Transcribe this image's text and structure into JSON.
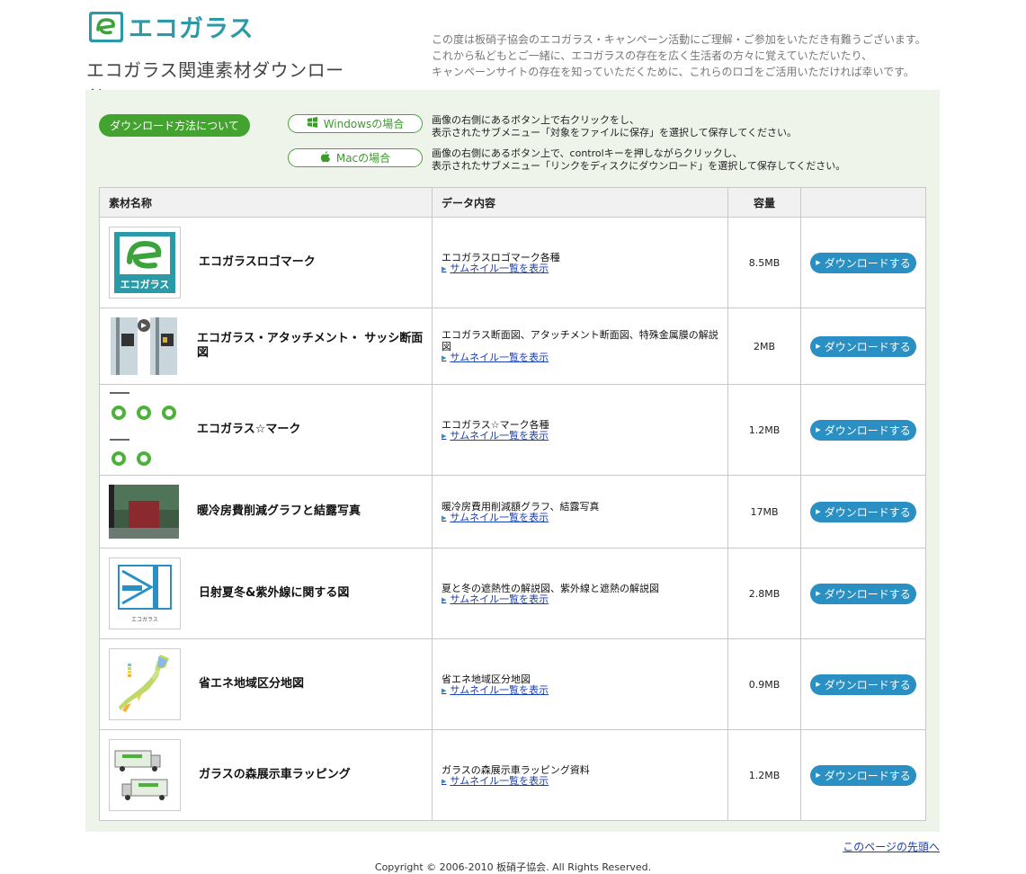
{
  "header": {
    "logo_text": "エコガラス",
    "page_title": "エコガラス関連素材ダウンロード",
    "intro": [
      "この度は板硝子協会のエコガラス・キャンペーン活動にご理解・ご参加をいただき有難うございます。",
      "これから私どもとご一緒に、エコガラスの存在を広く生活者の方々に覚えていただいたり、",
      "キャンペーンサイトの存在を知っていただくために、これらのロゴをご活用いただければ幸いです。"
    ]
  },
  "howto": {
    "button_label": "ダウンロード方法について",
    "windows_label": "Windowsの場合",
    "windows_desc": [
      "画像の右側にあるボタン上で右クリックをし、",
      "表示されたサブメニュー「対象をファイルに保存」を選択して保存してください。"
    ],
    "mac_label": "Macの場合",
    "mac_desc": [
      "画像の右側にあるボタン上で、controlキーを押しながらクリックし、",
      "表示されたサブメニュー「リンクをディスクにダウンロード」を選択して保存してください。"
    ]
  },
  "table": {
    "headers": [
      "素材名称",
      "データ内容",
      "容量",
      ""
    ],
    "thumbs_label": "サムネイル一覧を表示",
    "download_label": "ダウンロードする",
    "rows": [
      {
        "name": "エコガラスロゴマーク",
        "desc": "エコガラスロゴマーク各種",
        "size": "8.5MB"
      },
      {
        "name": "エコガラス・アタッチメント・ サッシ断面図",
        "desc": "エコガラス断面図、アタッチメント断面図、特殊金属膜の解説図",
        "size": "2MB"
      },
      {
        "name": "エコガラス☆マーク",
        "desc": "エコガラス☆マーク各種",
        "size": "1.2MB"
      },
      {
        "name": "暖冷房費削減グラフと結露写真",
        "desc": "暖冷房費用削減額グラフ、結露写真",
        "size": "17MB"
      },
      {
        "name": "日射夏冬&紫外線に関する図",
        "desc": "夏と冬の遮熱性の解説図、紫外線と遮熱の解説図",
        "size": "2.8MB"
      },
      {
        "name": "省エネ地域区分地図",
        "desc": "省エネ地域区分地図",
        "size": "0.9MB"
      },
      {
        "name": "ガラスの森展示車ラッピング",
        "desc": "ガラスの森展示車ラッピング資料",
        "size": "1.2MB"
      }
    ]
  },
  "footer": {
    "back_to_top": "このページの先頭へ",
    "copyright": "Copyright © 2006-2010 板硝子協会. All Rights Reserved."
  }
}
